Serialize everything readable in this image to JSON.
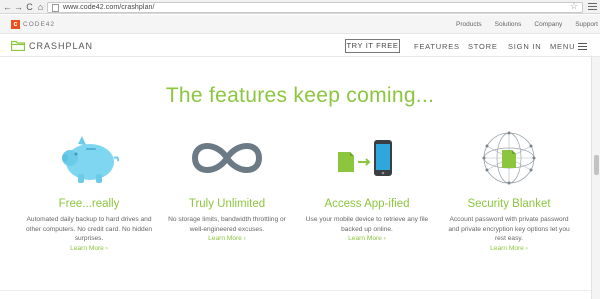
{
  "browser": {
    "url": "www.code42.com/crashplan/",
    "back_glyph": "←",
    "forward_glyph": "→",
    "reload_glyph": "C",
    "home_glyph": "⌂",
    "star_glyph": "☆"
  },
  "topbar": {
    "logo_mark": "c",
    "logo_text": "CODE42",
    "links": [
      "Products",
      "Solutions",
      "Company",
      "Support"
    ]
  },
  "navbar": {
    "brand": "CRASHPLAN",
    "try_button": "TRY IT FREE",
    "features": "FEATURES",
    "store": "STORE",
    "sign_in": "SIGN IN",
    "menu": "MENU"
  },
  "headline": "The features keep coming...",
  "features": [
    {
      "title": "Free...really",
      "description": "Automated daily backup to hard drives and other computers. No credit card. No hidden surprises.",
      "link": "Learn More ›",
      "icon": "piggy-bank-icon"
    },
    {
      "title": "Truly Unlimited",
      "description": "No storage limits, bandwidth throttling or well-engineered excuses.",
      "link": "Learn More ›",
      "icon": "infinity-icon"
    },
    {
      "title": "Access App-ified",
      "description": "Use your mobile device to retrieve any file backed up online.",
      "link": "Learn More ›",
      "icon": "mobile-access-icon"
    },
    {
      "title": "Security Blanket",
      "description": "Account password with private password and private encryption key options let you rest easy.",
      "link": "Learn More ›",
      "icon": "security-globe-icon"
    }
  ],
  "colors": {
    "accent_green": "#8cc63f",
    "code42_orange": "#e8511f",
    "piggy_blue": "#7fd6f0",
    "infinity_gray": "#6c7a86"
  }
}
